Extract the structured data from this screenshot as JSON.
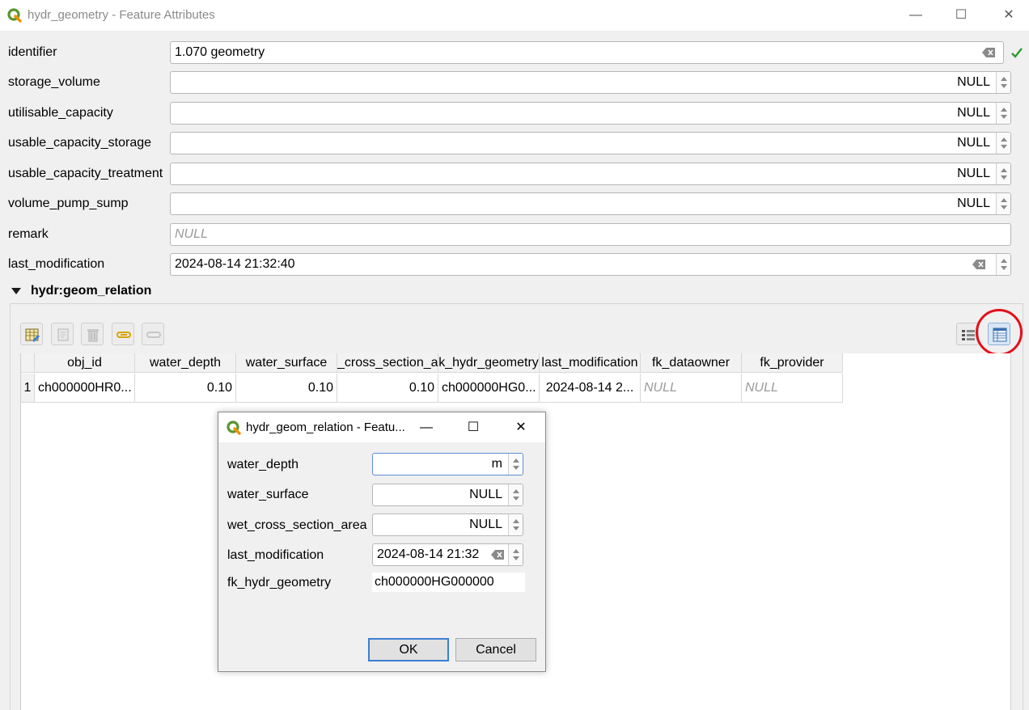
{
  "window": {
    "title": "hydr_geometry - Feature Attributes",
    "minimize": "—",
    "maximize": "☐",
    "close": "✕"
  },
  "form": {
    "fields": [
      {
        "label": "identifier",
        "value": "1.070 geometry"
      },
      {
        "label": "storage_volume",
        "value": "NULL"
      },
      {
        "label": "utilisable_capacity",
        "value": "NULL"
      },
      {
        "label": "usable_capacity_storage",
        "value": "NULL"
      },
      {
        "label": "usable_capacity_treatment",
        "value": "NULL"
      },
      {
        "label": "volume_pump_sump",
        "value": "NULL"
      },
      {
        "label": "remark",
        "placeholder": "NULL"
      },
      {
        "label": "last_modification",
        "value": "2024-08-14 21:32:40"
      }
    ]
  },
  "relation": {
    "title": "hydr:geom_relation",
    "table": {
      "headers": [
        "obj_id",
        "water_depth",
        "water_surface",
        "_cross_section_a",
        "k_hydr_geometry",
        "last_modification",
        "fk_dataowner",
        "fk_provider"
      ],
      "row_number": "1",
      "rows": [
        [
          "ch000000HR0...",
          "0.10",
          "0.10",
          "0.10",
          "ch000000HG0...",
          "2024-08-14 2...",
          "NULL",
          "NULL"
        ]
      ]
    }
  },
  "dialog": {
    "title": "hydr_geom_relation - Featu...",
    "minimize": "—",
    "maximize": "☐",
    "close": "✕",
    "fields": [
      {
        "label": "water_depth",
        "value": "m"
      },
      {
        "label": "water_surface",
        "value": "NULL"
      },
      {
        "label": "wet_cross_section_area",
        "value": "NULL"
      },
      {
        "label": "last_modification",
        "value": "2024-08-14 21:32"
      },
      {
        "label": "fk_hydr_geometry",
        "value": "ch000000HG000000"
      }
    ],
    "ok": "OK",
    "cancel": "Cancel"
  },
  "colors": {
    "qgis_green": "#589632",
    "qgis_yellow": "#ee9000",
    "check_green": "#2f9a2f",
    "highlight_red": "#e3101c"
  }
}
